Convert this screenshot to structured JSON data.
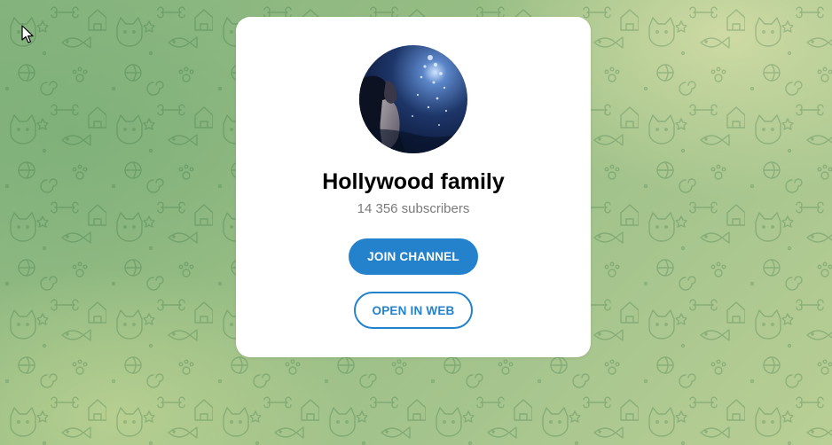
{
  "channel": {
    "name": "Hollywood family",
    "subscribers": "14 356 subscribers",
    "avatar_icon": "channel-avatar-photo"
  },
  "actions": {
    "join_label": "JOIN CHANNEL",
    "open_web_label": "OPEN IN WEB"
  },
  "colors": {
    "accent": "#2481cc",
    "background": "#96bd84",
    "card": "#ffffff",
    "subtitle": "#7a7a7a"
  },
  "background_pattern_icon": "doodle-pattern",
  "cursor_icon": "mouse-pointer-icon"
}
